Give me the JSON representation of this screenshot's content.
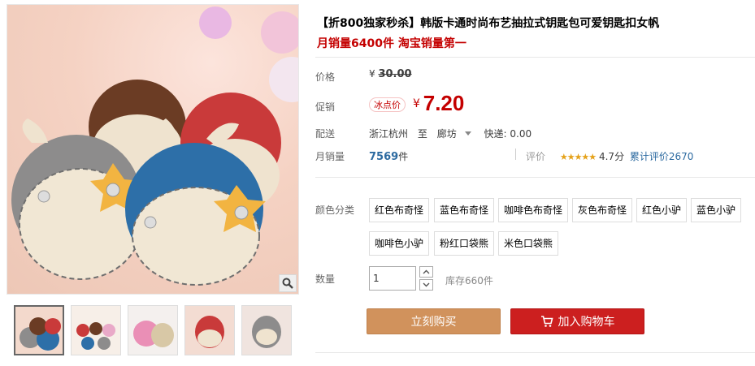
{
  "product": {
    "title": "【折800独家秒杀】韩版卡通时尚布艺抽拉式钥匙包可爱钥匙扣女帆",
    "subtitle": "月销量6400件 淘宝销量第一"
  },
  "price": {
    "label": "价格",
    "currency": "¥",
    "original": "30.00"
  },
  "promo": {
    "label": "促销",
    "tag": "冰点价",
    "currency": "¥",
    "price": "7.20"
  },
  "shipping": {
    "label": "配送",
    "from": "浙江杭州",
    "to_word": "至",
    "to": "廊坊",
    "express": "快递: 0.00"
  },
  "sales": {
    "label": "月销量",
    "count": "7569",
    "unit": "件"
  },
  "rating": {
    "label": "评价",
    "stars": "★★★★★",
    "score": "4.7分",
    "link": "累计评价2670"
  },
  "colors": {
    "label": "颜色分类",
    "options": [
      "红色布奇怪",
      "蓝色布奇怪",
      "咖啡色布奇怪",
      "灰色布奇怪",
      "红色小驴",
      "蓝色小驴",
      "咖啡色小驴",
      "粉红口袋熊",
      "米色口袋熊"
    ]
  },
  "quantity": {
    "label": "数量",
    "value": "1",
    "stock": "库存660件"
  },
  "buttons": {
    "buy": "立刻购买",
    "cart": "加入购物车"
  },
  "icons": {
    "zoom": "magnifier-icon",
    "cart": "cart-icon",
    "stepper_up": "chevron-up-icon",
    "stepper_down": "chevron-down-icon"
  },
  "colors_theme": {
    "price_red": "#c40000",
    "buy_button": "#d1925c",
    "cart_button": "#cc1f1f",
    "link_blue": "#2c6aa0"
  }
}
